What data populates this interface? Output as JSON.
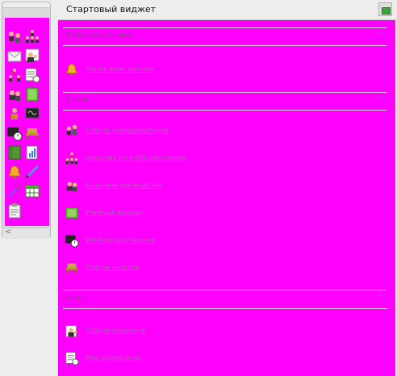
{
  "header": {
    "title": "Стартовый виджет"
  },
  "sidebar": {
    "collapse_label": "<",
    "icons": [
      "users-pair-icon",
      "users-group-icon",
      "mail-icon",
      "teacher-icon",
      "people-tree-icon",
      "schedule-list-icon",
      "users-team-icon",
      "green-journal-icon",
      "single-user-icon",
      "blackboard-icon",
      "schedule-clock-icon",
      "classroom-desk-icon",
      "green-book-icon",
      "report-chart-icon",
      "bell-icon",
      "pencil-icon",
      "pen-icon",
      "calendar-table-icon",
      "clipboard-icon"
    ]
  },
  "sections": [
    {
      "title": "Избранные ссылки",
      "caret": "^",
      "items": [
        {
          "label": "Расписание звонков",
          "icon": "bell-icon"
        }
      ]
    },
    {
      "title": "Школа",
      "caret": "^",
      "items": [
        {
          "label": "Список преподавателей",
          "icon": "users-pair-icon"
        },
        {
          "label": "Нагрузка по учебным планам",
          "icon": "people-tree-icon"
        },
        {
          "label": "Классное руководство",
          "icon": "users-team-icon"
        },
        {
          "label": "Учебный журнал",
          "icon": "green-journal-icon"
        },
        {
          "label": "Учебное расписание",
          "icon": "blackboard-clock-icon"
        },
        {
          "label": "Список классов",
          "icon": "classroom-desk-icon"
        }
      ]
    },
    {
      "title": "Класс",
      "caret": "^",
      "items": [
        {
          "label": "Список учащихся",
          "icon": "student-icon"
        },
        {
          "label": "Моё расписание",
          "icon": "schedule-list-icon"
        }
      ]
    }
  ],
  "colors": {
    "magenta": "#ff00ff",
    "link": "#a868a8",
    "header_bg": "#ededed"
  }
}
